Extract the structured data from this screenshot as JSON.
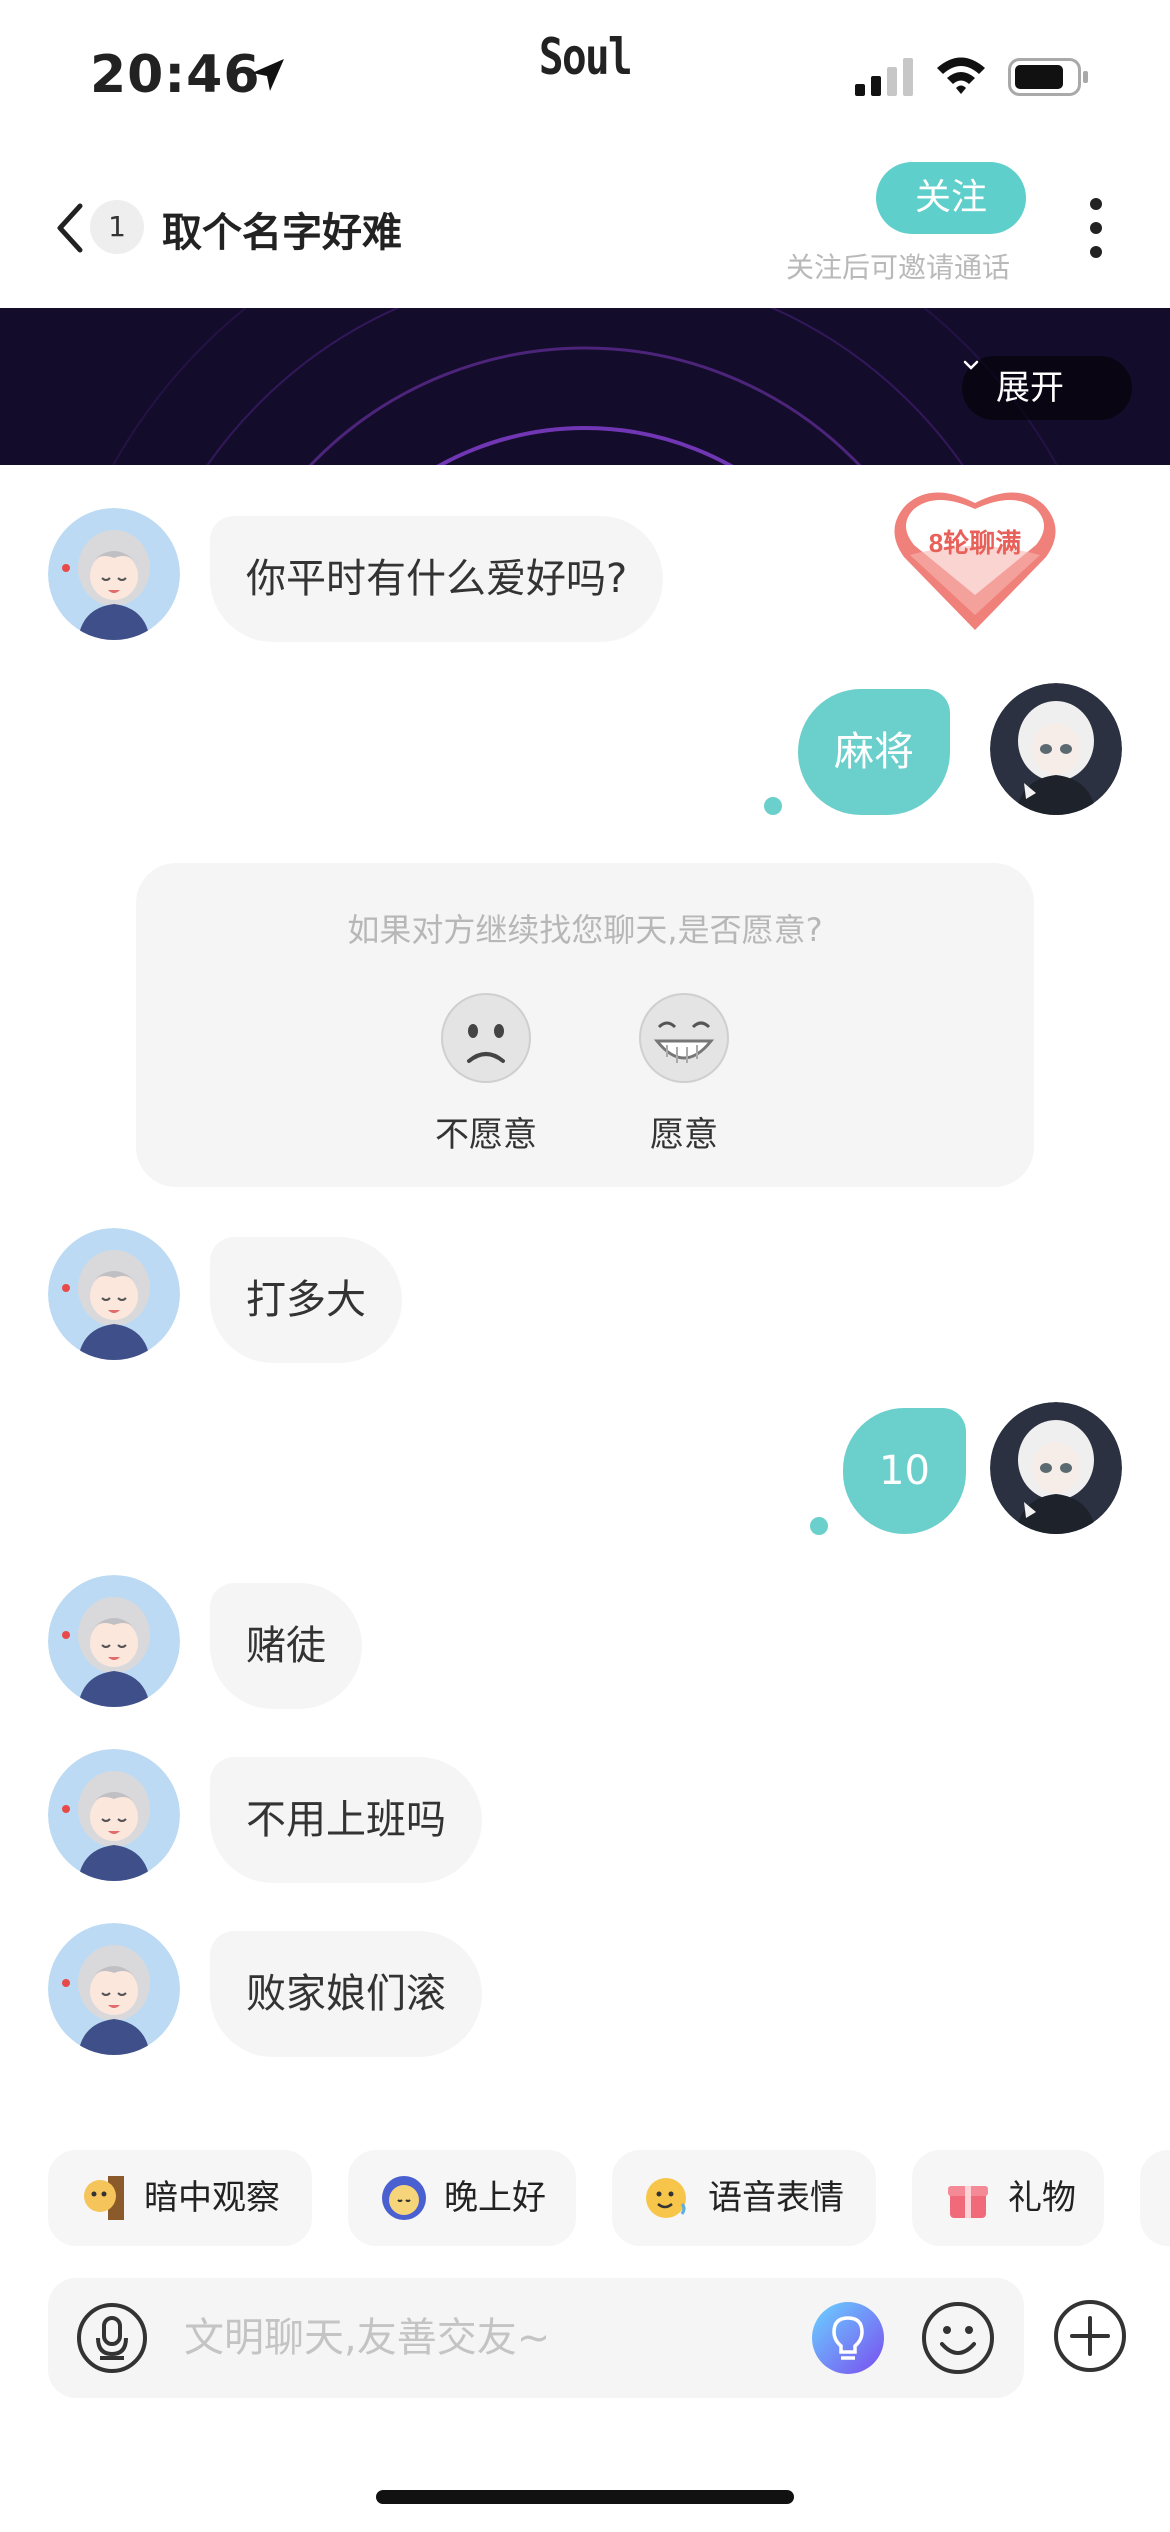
{
  "status_bar": {
    "time": "20:46",
    "app_logo": "Soul",
    "icons": [
      "location-arrow-icon",
      "cellular-signal-icon",
      "wifi-icon",
      "battery-icon"
    ]
  },
  "header": {
    "back_icon": "chevron-left-icon",
    "unread_count": "1",
    "title": "取个名字好难",
    "follow_label": "关注",
    "follow_hint": "关注后可邀请通话",
    "more_icon": "vertical-dots-icon"
  },
  "banner": {
    "expand_label": "展开"
  },
  "heart_badge": {
    "text": "8轮聊满"
  },
  "messages": [
    {
      "side": "left",
      "text": "你平时有什么爱好吗?"
    },
    {
      "side": "right",
      "text": "麻将"
    },
    {
      "side": "left",
      "text": "打多大"
    },
    {
      "side": "right",
      "text": "10"
    },
    {
      "side": "left",
      "text": "赌徒"
    },
    {
      "side": "left",
      "text": "不用上班吗"
    },
    {
      "side": "left",
      "text": "败家娘们滚"
    }
  ],
  "prompt_card": {
    "question": "如果对方继续找您聊天,是否愿意?",
    "options": [
      {
        "label": "不愿意",
        "icon": "frowning-face-icon"
      },
      {
        "label": "愿意",
        "icon": "grinning-face-icon"
      }
    ]
  },
  "quick_actions": [
    {
      "label": "暗中观察",
      "icon": "peeking-dog-icon"
    },
    {
      "label": "晚上好",
      "icon": "moon-face-icon"
    },
    {
      "label": "语音表情",
      "icon": "voice-emoji-icon"
    },
    {
      "label": "礼物",
      "icon": "gift-icon"
    }
  ],
  "composer": {
    "placeholder": "文明聊天,友善交友~",
    "value": "",
    "icons": [
      "voice-icon",
      "ai-bulb-icon",
      "emoji-icon",
      "plus-icon"
    ]
  },
  "colors": {
    "accent": "#6bd0cc",
    "follow_button": "#5ecfcb",
    "bubble_left": "#f5f5f5",
    "banner_bg": "#140c2b",
    "heart": "#f0807a"
  }
}
